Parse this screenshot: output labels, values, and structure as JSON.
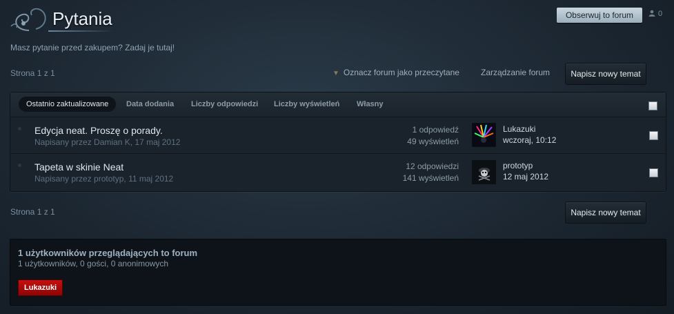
{
  "header": {
    "title": "Pytania",
    "description": "Masz pytanie przed zakupem? Zadaj je tutaj!",
    "follow_label": "Obserwuj to forum",
    "follow_count": "0"
  },
  "toolbar": {
    "page_info": "Strona 1 z 1",
    "mark_read": "Oznacz forum jako przeczytane",
    "manage": "Zarządzanie forum",
    "new_topic": "Napisz nowy temat"
  },
  "sort": {
    "items": [
      "Ostatnio zaktualizowane",
      "Data dodania",
      "Liczby odpowiedzi",
      "Liczby wyświetleń",
      "Własny"
    ]
  },
  "topics": [
    {
      "title": "Edycja neat. Proszę o porady.",
      "meta": "Napisany przez Damian K, 17 maj 2012",
      "replies": "1 odpowiedź",
      "views": "49 wyświetleń",
      "last_user": "Lukazuki",
      "last_time": "wczoraj, 10:12"
    },
    {
      "title": "Tapeta w skinie Neat",
      "meta": "Napisany przez prototyp, 11 maj 2012",
      "replies": "12 odpowiedzi",
      "views": "141 wyświetleń",
      "last_user": "prototyp",
      "last_time": "12 maj 2012"
    }
  ],
  "online": {
    "title": "1 użytkowników przeglądających to forum",
    "summary": "1 użytkowników, 0 gości, 0 anonimowych",
    "users": [
      "Lukazuki"
    ]
  },
  "icons": {
    "logo": "ornament-logo",
    "follow": "user-icon",
    "mark_read": "chevron-down-icon"
  }
}
